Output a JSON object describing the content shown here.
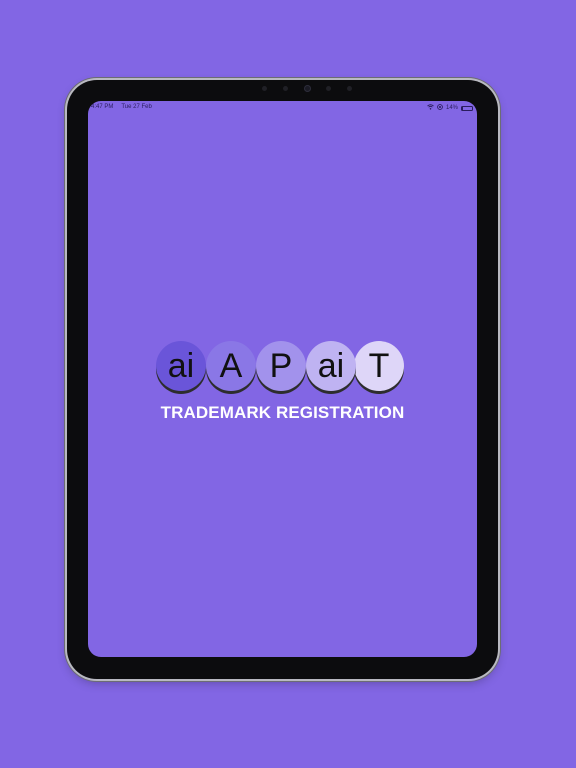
{
  "status_bar": {
    "time": "4:47 PM",
    "date": "Tue 27 Feb",
    "battery_percent": "14%",
    "battery_level": 0.14,
    "wifi_icon": "wifi-icon",
    "location_icon": "location-icon"
  },
  "logo": {
    "letters": [
      {
        "text": "ai",
        "color": "#6a55d9"
      },
      {
        "text": "A",
        "color": "#8a77e6"
      },
      {
        "text": "P",
        "color": "#a292ec"
      },
      {
        "text": "ai",
        "color": "#bfb3f2"
      },
      {
        "text": "T",
        "color": "#ded6f8"
      }
    ]
  },
  "tagline": "TRADEMARK REGISTRATION",
  "colors": {
    "background": "#8266e4",
    "bezel": "#0c0c0e",
    "tagline": "#ffffff"
  }
}
